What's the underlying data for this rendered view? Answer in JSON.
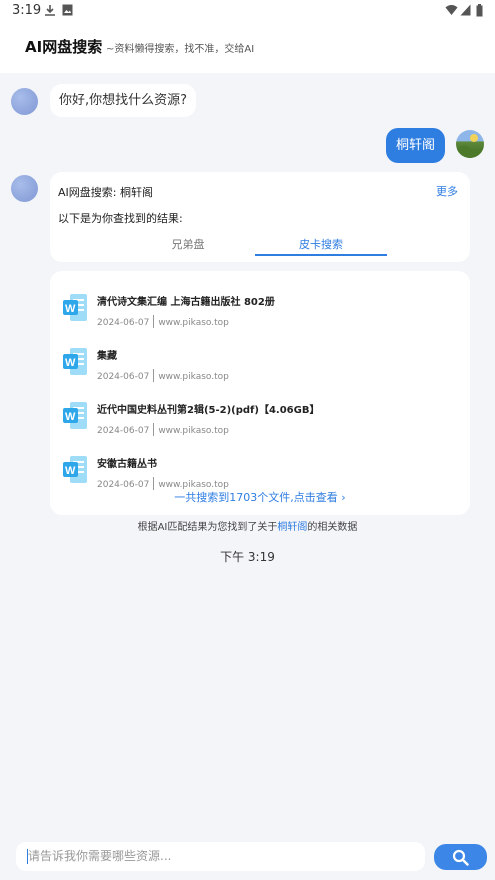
{
  "status_bar": {
    "time": "3:19"
  },
  "header": {
    "title": "AI网盘搜索",
    "subtitle": "~资料懒得搜索，找不准，交给AI"
  },
  "chat": {
    "bot_greeting": "你好,你想找什么资源?",
    "user_query": "桐轩阁",
    "result_header": {
      "title": "AI网盘搜索: 桐轩阁",
      "more_label": "更多",
      "description": "以下是为你查找到的结果:",
      "tabs": [
        {
          "label": "兄弟盘",
          "active": false
        },
        {
          "label": "皮卡搜索",
          "active": true
        }
      ]
    },
    "results": [
      {
        "name": "清代诗文集汇编 上海古籍出版社 802册",
        "date": "2024-06-07",
        "source": "www.pikaso.top",
        "icon": "word-doc-icon"
      },
      {
        "name": "集藏",
        "date": "2024-06-07",
        "source": "www.pikaso.top",
        "icon": "word-doc-icon"
      },
      {
        "name": "近代中国史料丛刊第2辑(5-2)(pdf)【4.06GB】",
        "date": "2024-06-07",
        "source": "www.pikaso.top",
        "icon": "word-doc-icon"
      },
      {
        "name": "安徽古籍丛书",
        "date": "2024-06-07",
        "source": "www.pikaso.top",
        "icon": "word-doc-icon"
      }
    ],
    "total_link": "一共搜索到1703个文件,点击查看 ›",
    "footer_note": {
      "prefix": "根据AI匹配结果为您找到了关于",
      "keyword": "桐轩阁",
      "suffix": "的相关数据"
    },
    "timestamp": "下午 3:19"
  },
  "input": {
    "placeholder": "请告诉我你需要哪些资源...",
    "search_icon": "search-icon"
  },
  "colors": {
    "accent": "#2e7de1",
    "background": "#f4f5f9",
    "card": "#ffffff"
  }
}
